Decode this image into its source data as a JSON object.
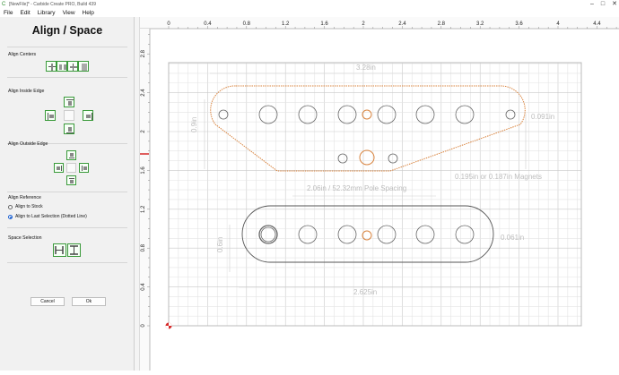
{
  "window": {
    "title": "[NewFile]* - Carbide Create PRO, Build 439"
  },
  "menu": [
    "File",
    "Edit",
    "Library",
    "View",
    "Help"
  ],
  "panel": {
    "title": "Align / Space",
    "align_centers_label": "Align Centers",
    "align_inside_label": "Align Inside Edge",
    "align_outside_label": "Align Outside Edge",
    "align_reference_label": "Align Reference",
    "reference_options": [
      "Align to Stock",
      "Align to Last Selection (Dotted Line)"
    ],
    "reference_selected": "Align to Last Selection (Dotted Line)",
    "space_selection_label": "Space Selection",
    "cancel_label": "Cancel",
    "ok_label": "Ok"
  },
  "ruler": {
    "x_ticks": [
      "0",
      "0.4",
      "0.8",
      "1.2",
      "1.6",
      "2",
      "2.4",
      "2.8",
      "3.2",
      "3.6",
      "4",
      "4.4"
    ],
    "y_ticks": [
      "2.8",
      "2.4",
      "2",
      "1.6",
      "1.2",
      "0.8",
      "0.4",
      "0"
    ]
  },
  "dimensions": {
    "top_width": "3.28in",
    "top_height": "0.9in",
    "top_hole": "0.091in",
    "magnets": "0.195in or 0.187in Magnets",
    "pole_spacing": "2.06in / 52.32mm Pole Spacing",
    "bottom_height": "0.6in",
    "bottom_hole": "0.061in",
    "bottom_width": "2.625in"
  },
  "colors": {
    "selected_outline": "#d9843f",
    "outline": "#555555",
    "grid_minor": "#e4e4e4",
    "grid_major": "#c9c9c9",
    "dim_text": "#bdbdbd",
    "accent_green": "#3a9a3a"
  }
}
